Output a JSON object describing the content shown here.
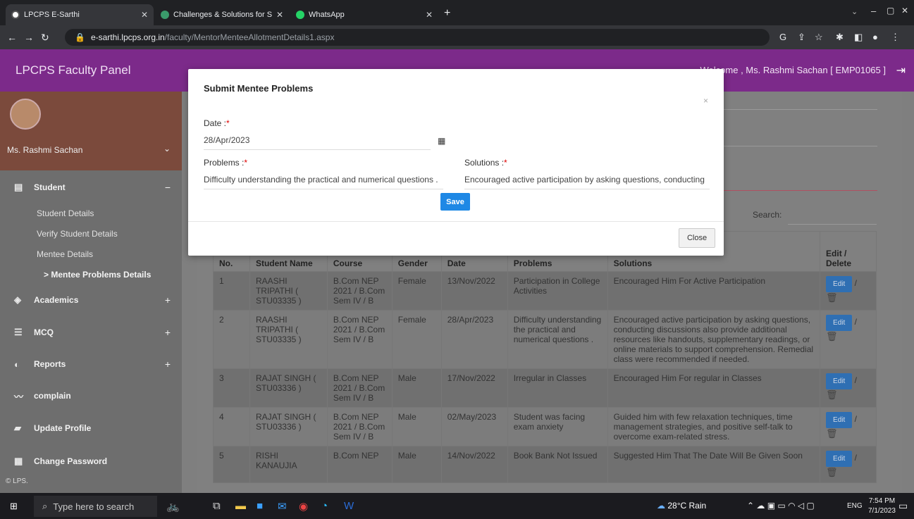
{
  "browser": {
    "tabs": [
      {
        "title": "LPCPS E-Sarthi",
        "active": true
      },
      {
        "title": "Challenges & Solutions for Stude",
        "active": false
      },
      {
        "title": "WhatsApp",
        "active": false
      }
    ],
    "url_host": "e-sarthi.lpcps.org.in",
    "url_path": "/faculty/MentorMenteeAllotmentDetails1.aspx"
  },
  "app": {
    "brand": "LPCPS Faculty Panel",
    "welcome": "Welcome , Ms. Rashmi Sachan [ EMP01065 ]"
  },
  "sidebar": {
    "profile_name": "Ms. Rashmi Sachan",
    "student_label": "Student",
    "student_toggle": "−",
    "student_items": [
      "Student Details",
      "Verify Student Details",
      "Mentee Details"
    ],
    "active_item": "> Mentee Problems Details",
    "menus": [
      {
        "label": "Academics",
        "toggle": "+"
      },
      {
        "label": "MCQ",
        "toggle": "+"
      },
      {
        "label": "Reports",
        "toggle": "+"
      },
      {
        "label": "complain",
        "toggle": ""
      },
      {
        "label": "Update Profile",
        "toggle": ""
      },
      {
        "label": "Change Password",
        "toggle": ""
      }
    ],
    "footer": "© LPS."
  },
  "search_label": "Search:",
  "table": {
    "headers": [
      "No.",
      "Student Name",
      "Course",
      "Gender",
      "Date",
      "Problems",
      "Solutions",
      "Edit / Delete"
    ],
    "rows": [
      {
        "no": "1",
        "name": "RAASHI TRIPATHI ( STU03335 )",
        "course": "B.Com NEP 2021 / B.Com Sem IV / B",
        "gender": "Female",
        "date": "13/Nov/2022",
        "problem": "Participation in College Activities",
        "solution": "Encouraged Him For Active Participation"
      },
      {
        "no": "2",
        "name": "RAASHI TRIPATHI ( STU03335 )",
        "course": "B.Com NEP 2021 / B.Com Sem IV / B",
        "gender": "Female",
        "date": "28/Apr/2023",
        "problem": "Difficulty understanding the practical and numerical questions .",
        "solution": "Encouraged active participation by asking questions, conducting discussions also provide additional resources like handouts, supplementary readings, or online materials to support comprehension. Remedial class were recommended if needed."
      },
      {
        "no": "3",
        "name": "RAJAT SINGH ( STU03336 )",
        "course": "B.Com NEP 2021 / B.Com Sem IV / B",
        "gender": "Male",
        "date": "17/Nov/2022",
        "problem": "Irregular in Classes",
        "solution": "Encouraged Him For regular in Classes"
      },
      {
        "no": "4",
        "name": "RAJAT SINGH ( STU03336 )",
        "course": "B.Com NEP 2021 / B.Com Sem IV / B",
        "gender": "Male",
        "date": "02/May/2023",
        "problem": "Student was facing exam anxiety",
        "solution": "Guided him with few relaxation techniques, time management strategies, and positive self-talk to overcome exam-related stress."
      },
      {
        "no": "5",
        "name": "RISHI KANAUJIA",
        "course": "B.Com NEP",
        "gender": "Male",
        "date": "14/Nov/2022",
        "problem": "Book Bank Not Issued",
        "solution": "Suggested Him That The Date Will Be Given Soon"
      }
    ],
    "edit_label": "Edit"
  },
  "modal": {
    "title": "Submit Mentee Problems",
    "close_x": "×",
    "date_label": "Date :",
    "date_value": "28/Apr/2023",
    "problems_label": "Problems :",
    "problems_value": "Difficulty understanding the practical and numerical questions .",
    "solutions_label": "Solutions :",
    "solutions_value": "Encouraged active participation by asking questions, conducting",
    "required_mark": "*",
    "save_label": "Save",
    "close_label": "Close"
  },
  "taskbar": {
    "search_placeholder": "Type here to search",
    "weather": "28°C  Rain",
    "lang": "ENG",
    "time": "7:54 PM",
    "date": "7/1/2023"
  },
  "colors": {
    "header_purple": "#7c2a8a",
    "save_blue": "#1e88e5",
    "edit_blue": "#2f6fb3"
  }
}
